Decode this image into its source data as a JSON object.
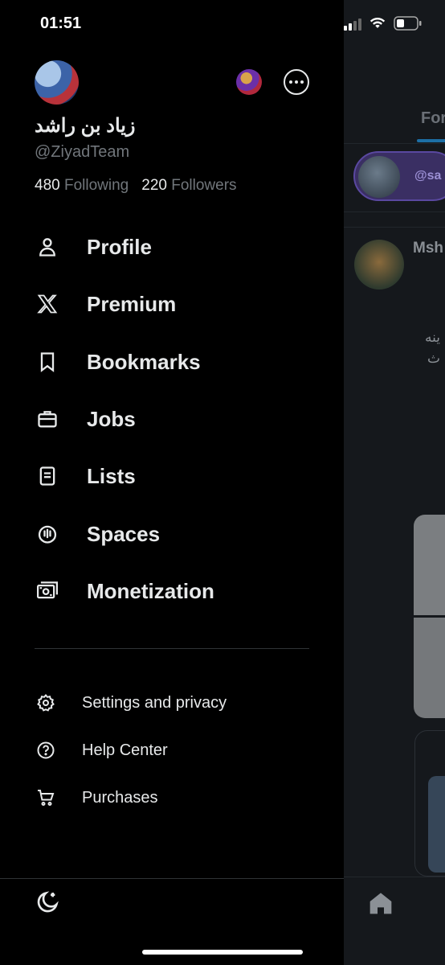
{
  "status": {
    "time": "01:51"
  },
  "account": {
    "name": "زياد بن راشد",
    "handle": "@ZiyadTeam",
    "following_count": "480",
    "following_label": "Following",
    "followers_count": "220",
    "followers_label": "Followers"
  },
  "menu": {
    "items": [
      {
        "label": "Profile",
        "icon": "person-icon"
      },
      {
        "label": "Premium",
        "icon": "x-logo-icon"
      },
      {
        "label": "Bookmarks",
        "icon": "bookmark-icon"
      },
      {
        "label": "Jobs",
        "icon": "briefcase-icon"
      },
      {
        "label": "Lists",
        "icon": "list-icon"
      },
      {
        "label": "Spaces",
        "icon": "spaces-icon"
      },
      {
        "label": "Monetization",
        "icon": "money-icon"
      }
    ],
    "secondary": [
      {
        "label": "Settings and privacy",
        "icon": "gear-icon"
      },
      {
        "label": "Help Center",
        "icon": "help-icon"
      },
      {
        "label": "Purchases",
        "icon": "cart-icon"
      }
    ]
  },
  "background_feed": {
    "tab_label": "For",
    "pill_handle": "@sa",
    "post_author": "Msh",
    "text_line1": "ينه",
    "text_line2": "ث"
  },
  "colors": {
    "background": "#000000",
    "text": "#e7e9ea",
    "muted": "#71767b",
    "accent": "#1d9bf0"
  }
}
